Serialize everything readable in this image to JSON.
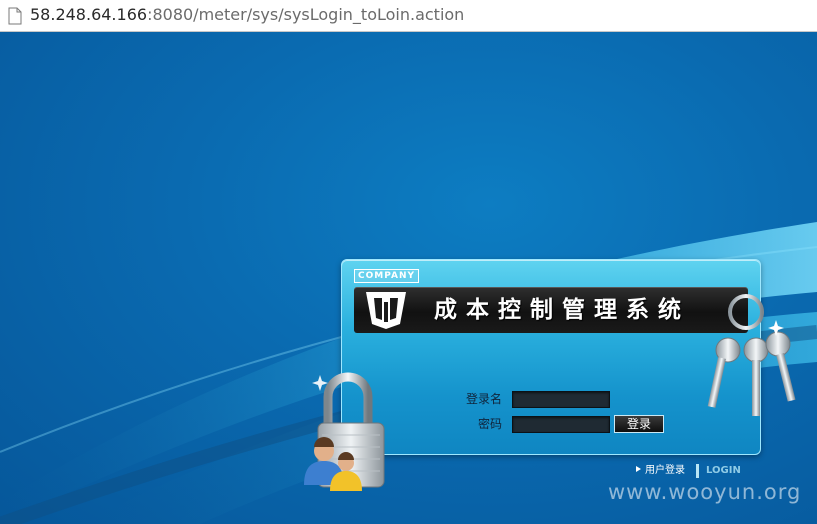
{
  "browser": {
    "url_host": "58.248.64.166",
    "url_path": ":8080/meter/sys/sysLogin_toLoin.action",
    "page_icon": "document-icon"
  },
  "login_panel": {
    "company_tag": "COMPANY",
    "title": "成本控制管理系统",
    "logo_icon": "company-logo-icon",
    "username_label": "登录名",
    "username_value": "",
    "password_label": "密码",
    "password_value": "",
    "login_button": "登录",
    "user_login_link": "用户登录",
    "login_en": "LOGIN"
  },
  "decorations": {
    "lock_icon": "padlock-users-icon",
    "keys_icon": "keys-icon"
  },
  "watermark": "www.wooyun.org",
  "colors": {
    "background": "#0a6ab0",
    "panel": "#2ab0de",
    "title_bar": "#111111"
  }
}
